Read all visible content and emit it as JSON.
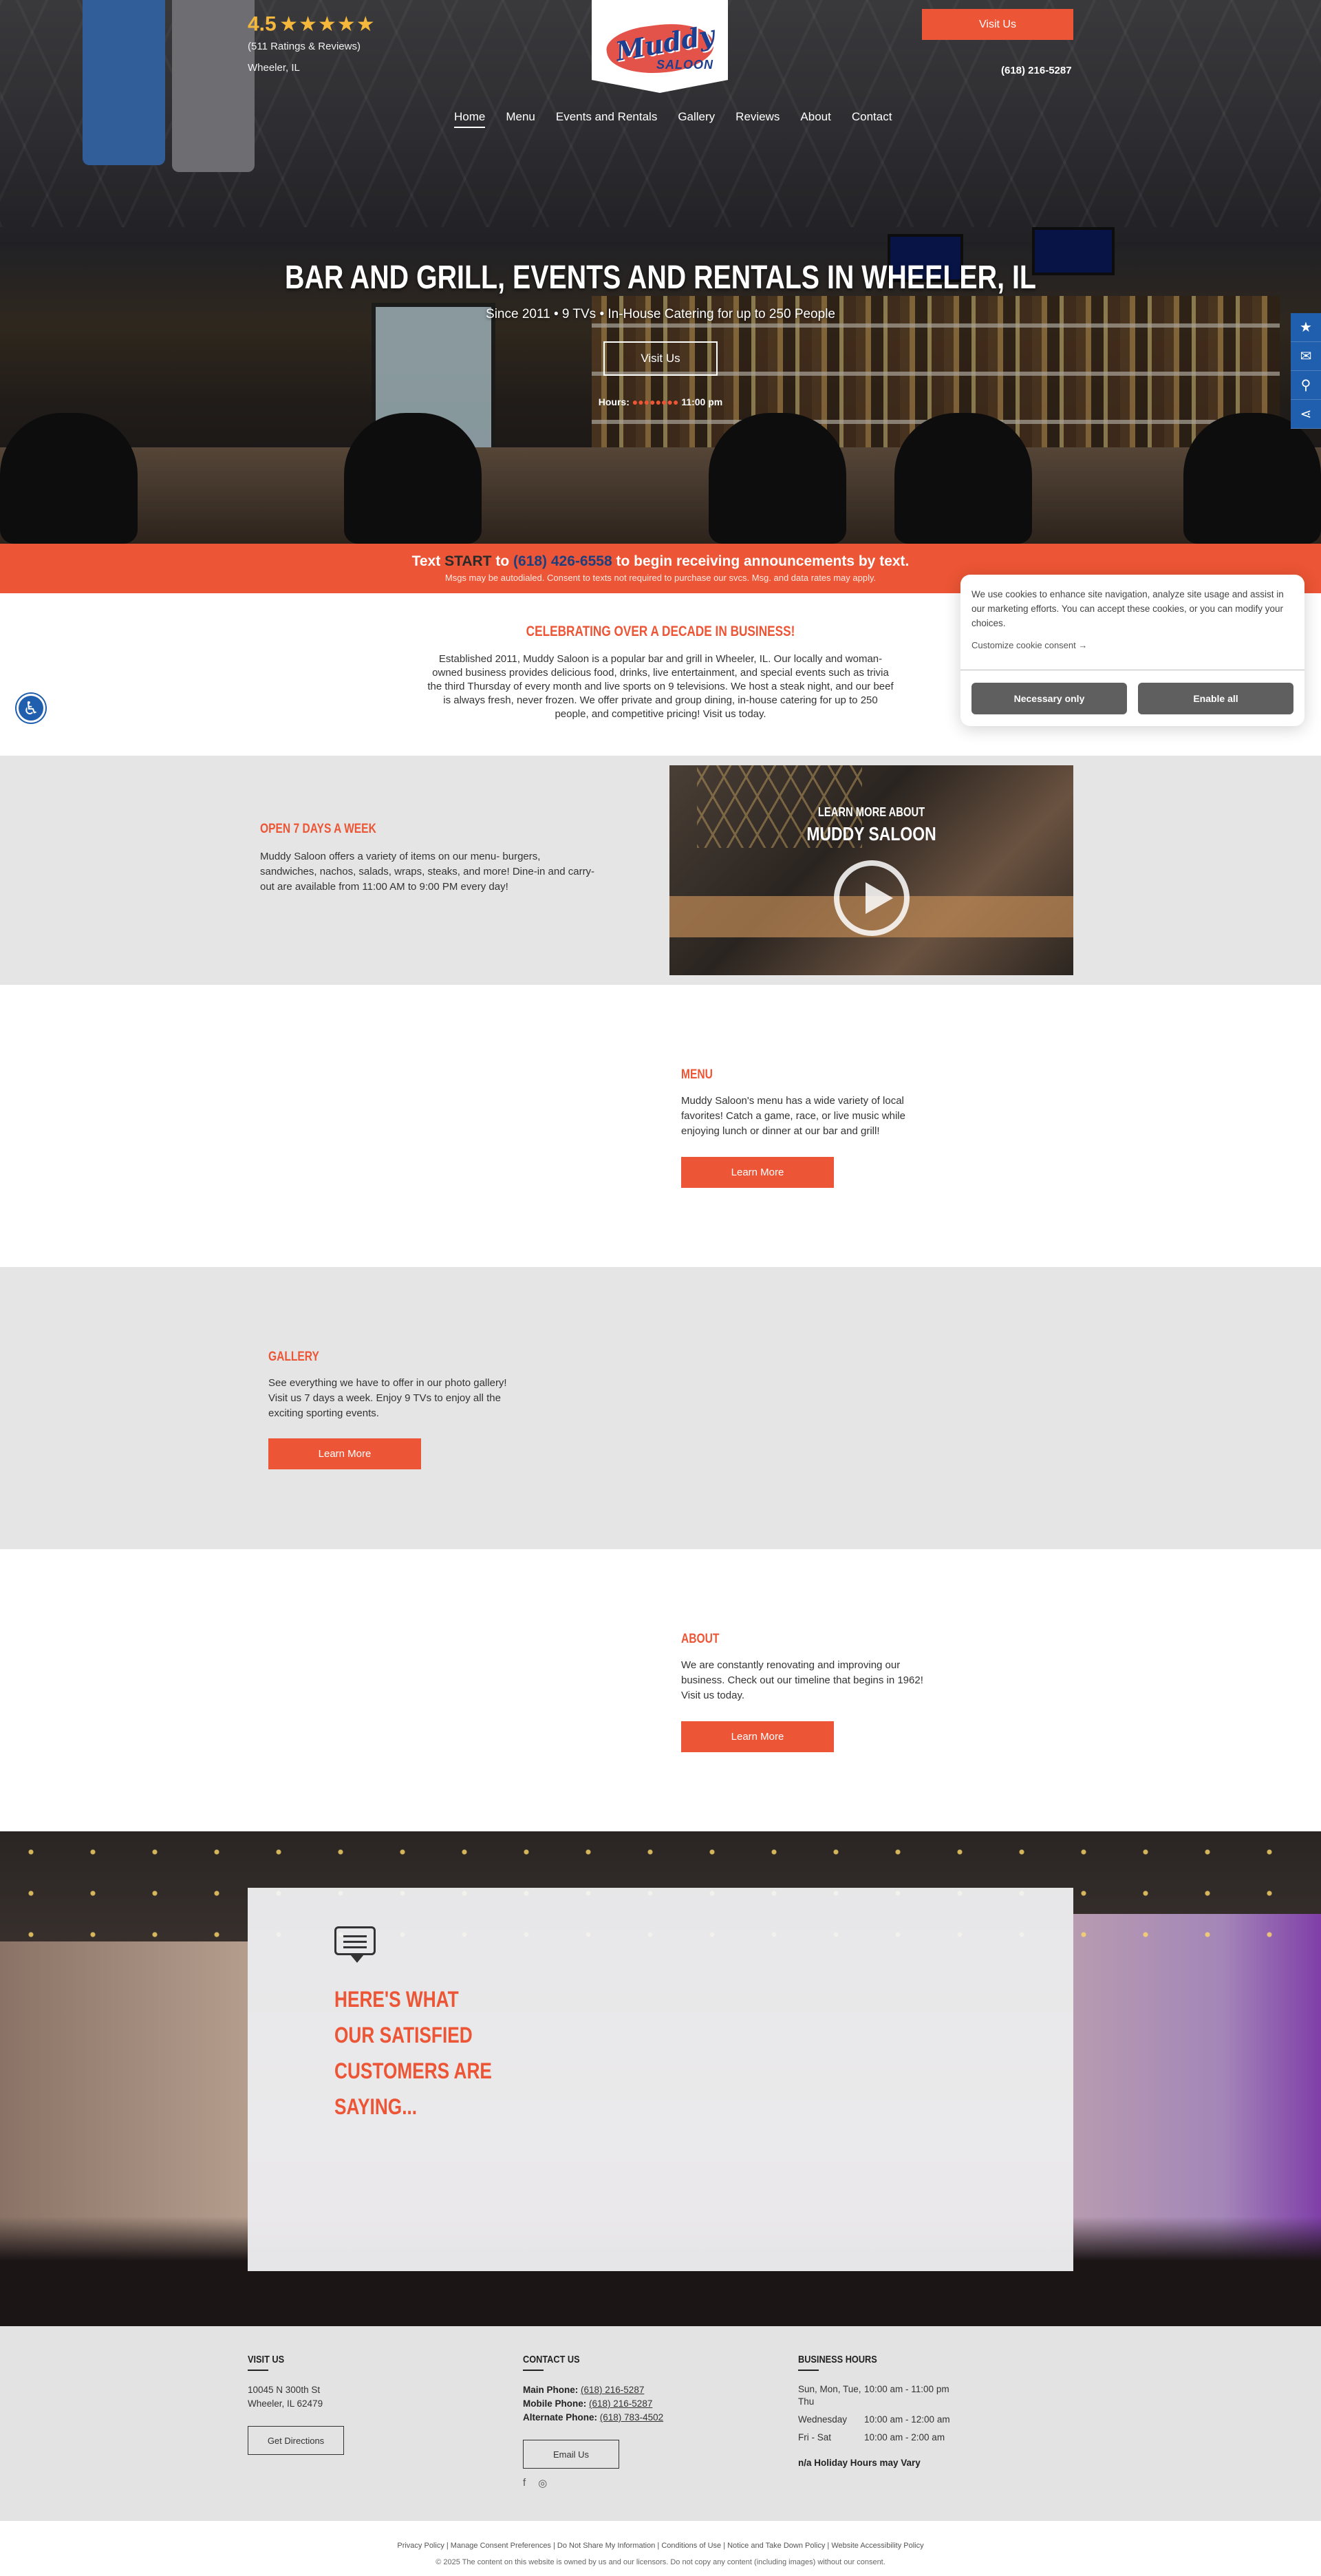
{
  "header": {
    "rating_value": "4.5",
    "rating_stars": "★★★★★",
    "rating_count": "(511 Ratings & Reviews)",
    "location": "Wheeler, IL",
    "logo_script": "Muddy",
    "logo_sub": "SALOON",
    "visit_button": "Visit Us",
    "phone": "(618) 216-5287",
    "nav": [
      "Home",
      "Menu",
      "Events and Rentals",
      "Gallery",
      "Reviews",
      "About",
      "Contact"
    ]
  },
  "hero": {
    "title": "BAR AND GRILL, EVENTS AND RENTALS IN WHEELER, IL",
    "subtitle": "Since 2011  •  9 TVs  •  In-House Catering for up to 250 People",
    "visit_button": "Visit Us",
    "hours_label": "Hours:",
    "hours_value": "11:00 pm"
  },
  "side_tabs": [
    "star-icon",
    "envelope-icon",
    "map-pin-icon",
    "share-icon"
  ],
  "text_bar": {
    "pre": "Text ",
    "keyword": "START",
    "mid": " to ",
    "number": "(618) 426-6558",
    "post": " to begin receiving announcements by text.",
    "fine_print": "Msgs may be autodialed. Consent to texts not required to purchase our svcs. Msg. and data rates may apply."
  },
  "intro": {
    "heading": "CELEBRATING OVER A DECADE IN BUSINESS!",
    "body": "Established 2011, Muddy Saloon is a popular bar and grill in Wheeler, IL. Our locally and woman-owned business provides delicious food, drinks, live entertainment, and special events such as trivia the third Thursday of every month and live sports on 9 televisions. We host a steak night, and our beef is always fresh, never frozen. We offer private and group dining, in-house catering for up to 250 people, and competitive pricing! Visit us today."
  },
  "cookie": {
    "text": "We use cookies to enhance site navigation, analyze site usage and assist in our marketing efforts. You can accept these cookies, or you can modify your choices.",
    "customize": "Customize cookie consent →",
    "necessary": "Necessary only",
    "enable": "Enable all"
  },
  "open_section": {
    "heading": "OPEN 7 DAYS A WEEK",
    "body": "Muddy Saloon offers a variety of items on our menu- burgers, sandwiches, nachos, salads, wraps, steaks, and more! Dine-in and carry-out are available from 11:00 AM to 9:00 PM every day!",
    "video_line1": "LEARN MORE ABOUT",
    "video_line2": "MUDDY SALOON"
  },
  "menu_section": {
    "heading": "MENU",
    "body": "Muddy Saloon's menu has a wide variety of local favorites! Catch a game, race, or live music while enjoying lunch or dinner at our bar and grill!",
    "button": "Learn More"
  },
  "gallery_section": {
    "heading": "GALLERY",
    "body": "See everything we have to offer in our photo gallery! Visit us 7 days a week. Enjoy 9 TVs to enjoy all the exciting sporting events.",
    "button": "Learn More"
  },
  "about_section": {
    "heading": "ABOUT",
    "body": "We are constantly renovating and improving our business. Check out our timeline that begins in 1962! Visit us today.",
    "button": "Learn More"
  },
  "testimonials": {
    "heading": "HERE'S WHAT OUR SATISFIED CUSTOMERS ARE SAYING..."
  },
  "footer": {
    "visit_heading": "VISIT US",
    "address1": "10045 N 300th St",
    "address2": "Wheeler, IL 62479",
    "directions_button": "Get Directions",
    "contact_heading": "CONTACT US",
    "main_label": "Main Phone:",
    "main_phone": "(618) 216-5287",
    "mobile_label": "Mobile Phone:",
    "mobile_phone": "(618) 216-5287",
    "alt_label": "Alternate Phone:",
    "alt_phone": "(618) 783-4502",
    "email_button": "Email Us",
    "social": [
      "facebook-icon",
      "instagram-icon"
    ],
    "hours_heading": "BUSINESS HOURS",
    "hours": [
      {
        "days": "Sun, Mon, Tue, Thu",
        "time": "10:00 am - 11:00 pm"
      },
      {
        "days": "Wednesday",
        "time": "10:00 am - 12:00 am"
      },
      {
        "days": "Fri - Sat",
        "time": "10:00 am - 2:00 am"
      }
    ],
    "holiday_note": "n/a Holiday Hours may Vary"
  },
  "legal": {
    "links": "Privacy Policy | Manage Consent Preferences | Do Not Share My Information | Conditions of Use | Notice and Take Down Policy | Website Accessibility Policy",
    "copyright": "© 2025 The content on this website is owned by us and our licensors. Do not copy any content (including images) without our consent."
  },
  "colors": {
    "accent": "#ec5535",
    "brand_blue": "#1f5fae",
    "star": "#f5b83d",
    "section_gray": "#e5e5e5"
  }
}
